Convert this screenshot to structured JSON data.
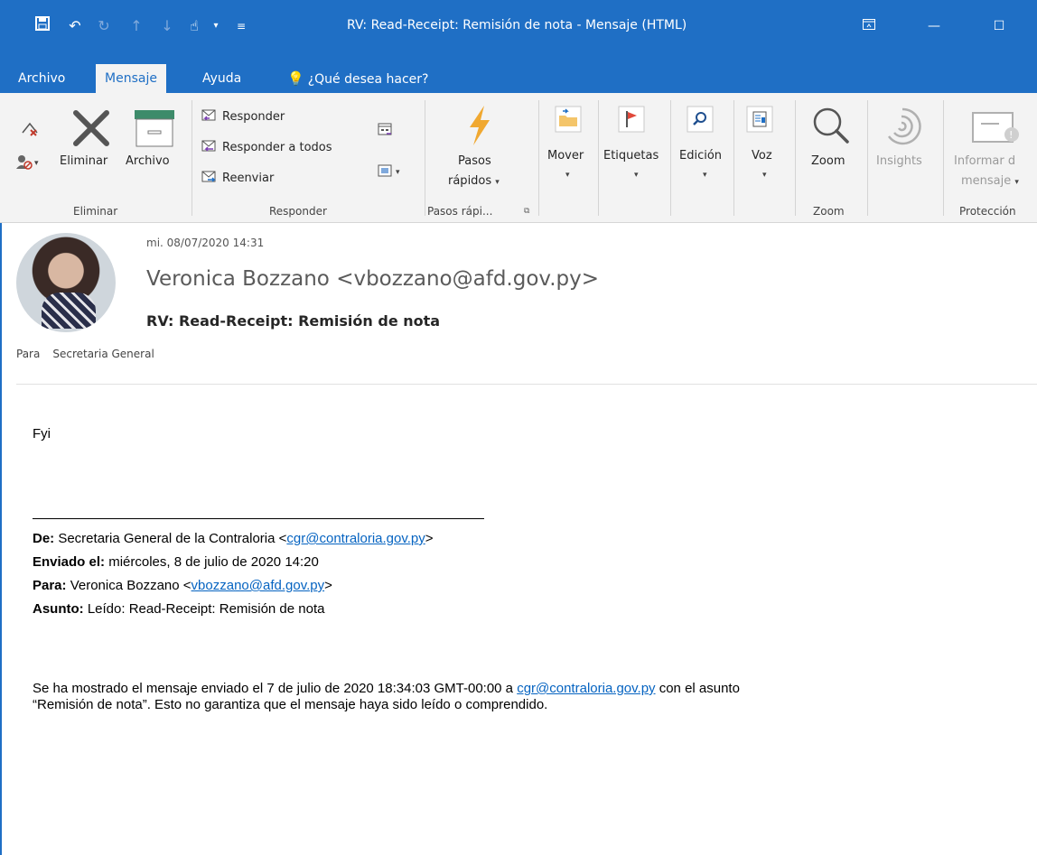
{
  "window": {
    "title": "RV: Read-Receipt: Remisión de nota  -  Mensaje (HTML)"
  },
  "tabs": [
    {
      "label": "Archivo"
    },
    {
      "label": "Mensaje"
    },
    {
      "label": "Ayuda"
    },
    {
      "label": "¿Qué desea hacer?"
    }
  ],
  "ribbon": {
    "eliminar_group": {
      "label": "Eliminar",
      "delete_label": "Eliminar",
      "archive_label": "Archivo"
    },
    "responder_group": {
      "label": "Responder",
      "reply": "Responder",
      "reply_all": "Responder a todos",
      "forward": "Reenviar"
    },
    "pasos_group": {
      "label": "Pasos rápi...",
      "button_line1": "Pasos",
      "button_line2": "rápidos"
    },
    "mover": "Mover",
    "etiquetas": "Etiquetas",
    "edicion": "Edición",
    "voz": "Voz",
    "zoom_group": {
      "label": "Zoom",
      "button": "Zoom"
    },
    "insights": "Insights",
    "proteccion_group": {
      "label": "Protección",
      "line1": "Informar d",
      "line2": "mensaje"
    }
  },
  "message": {
    "date": "mi. 08/07/2020 14:31",
    "sender": "Veronica Bozzano <vbozzano@afd.gov.py>",
    "subject": "RV: Read-Receipt: Remisión de nota",
    "to_label": "Para",
    "to_value": "Secretaria General"
  },
  "body": {
    "greeting": "Fyi",
    "from_label": "De:",
    "from_text": " Secretaria General de la Contraloria <",
    "from_email": "cgr@contraloria.gov.py",
    "from_close": ">",
    "sent_label": "Enviado el:",
    "sent_value": " miércoles, 8 de julio de 2020 14:20",
    "to_label": "Para:",
    "to_text": " Veronica Bozzano <",
    "to_email": "vbozzano@afd.gov.py",
    "to_close": ">",
    "subject_label": "Asunto:",
    "subject_value": " Leído: Read-Receipt: Remisión de nota",
    "para1_start": "Se ha mostrado el mensaje enviado el 7 de julio de 2020 18:34:03 GMT-00:00 a ",
    "para1_email": "cgr@contraloria.gov.py",
    "para1_end": " con el asunto",
    "para2": "“Remisión de nota”. Esto no garantiza que el mensaje haya sido leído o comprendido."
  }
}
